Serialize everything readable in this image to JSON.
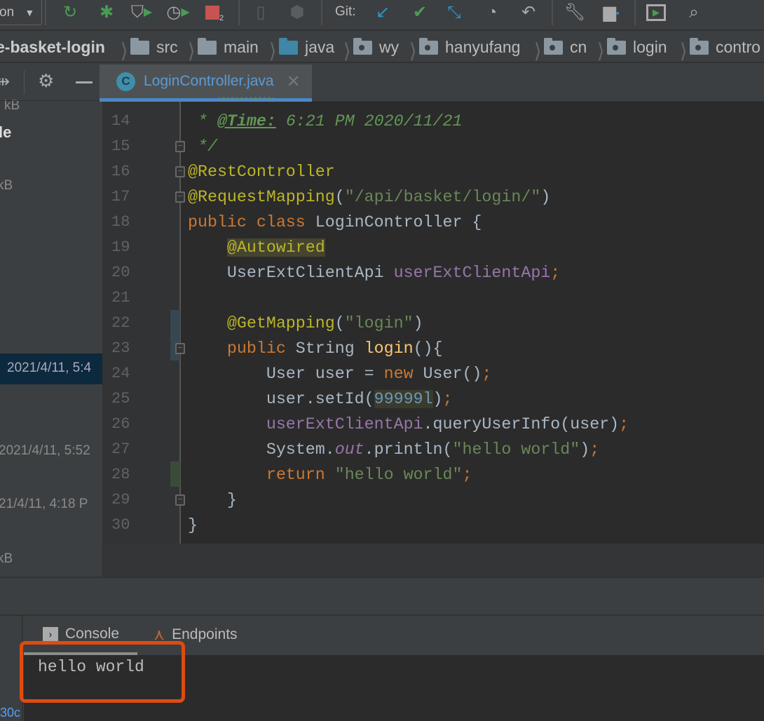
{
  "toolbar": {
    "run_config": "on",
    "stop_badge": "2",
    "git_label": "Git:",
    "icons": [
      "rerun-icon",
      "debug-icon",
      "coverage-icon",
      "profile-icon",
      "stop-icon",
      "device-icon",
      "deploy-icon",
      "git-update-icon",
      "git-commit-icon",
      "git-merge-icon",
      "history-icon",
      "rollback-icon",
      "wrench-icon",
      "project-structure-icon",
      "run-window-icon",
      "search-icon"
    ],
    "colors": {
      "green": "#499c54",
      "red": "#c75450",
      "blue": "#3592c4"
    }
  },
  "breadcrumb": [
    {
      "label": "e-basket-login",
      "icon": "module"
    },
    {
      "label": "src",
      "icon": "folder"
    },
    {
      "label": "main",
      "icon": "folder"
    },
    {
      "label": "java",
      "icon": "source-folder"
    },
    {
      "label": "wy",
      "icon": "package"
    },
    {
      "label": "hanyufang",
      "icon": "package"
    },
    {
      "label": "cn",
      "icon": "package"
    },
    {
      "label": "login",
      "icon": "package"
    },
    {
      "label": "contro",
      "icon": "package"
    }
  ],
  "left_panel": {
    "rows": [
      "kB",
      "le",
      "kB",
      "2021/4/11, 5:4",
      "2021/4/11, 5:52",
      "21/4/11, 4:18 P",
      "kB",
      "30c"
    ]
  },
  "editor": {
    "tab": {
      "name": "LoginController.java",
      "icon": "C"
    },
    "lines": [
      {
        "n": "14",
        "fold": false,
        "tokens": [
          [
            " * ",
            "cmt"
          ],
          [
            "@Time:",
            "tag"
          ],
          [
            " 6:21 PM 2020/11/21",
            "cmt"
          ]
        ]
      },
      {
        "n": "15",
        "fold": true,
        "tokens": [
          [
            " */",
            "cmt"
          ]
        ]
      },
      {
        "n": "16",
        "fold": true,
        "tokens": [
          [
            "@RestController",
            "ann"
          ]
        ]
      },
      {
        "n": "17",
        "fold": true,
        "tokens": [
          [
            "@RequestMapping",
            "ann"
          ],
          [
            "(",
            ""
          ],
          [
            "\"/api/basket/login/\"",
            "str"
          ],
          [
            ")",
            ""
          ]
        ]
      },
      {
        "n": "18",
        "fold": false,
        "tokens": [
          [
            "public class ",
            "kw"
          ],
          [
            "LoginController {",
            ""
          ]
        ]
      },
      {
        "n": "19",
        "fold": false,
        "tokens": [
          [
            "    ",
            ""
          ],
          [
            "@Autowired",
            "ann hl"
          ]
        ]
      },
      {
        "n": "20",
        "fold": false,
        "tokens": [
          [
            "    UserExtClientApi ",
            ""
          ],
          [
            "userExtClientApi",
            "field"
          ],
          [
            ";",
            "kw"
          ]
        ]
      },
      {
        "n": "21",
        "fold": false,
        "tokens": []
      },
      {
        "n": "22",
        "fold": false,
        "tokens": [
          [
            "    ",
            ""
          ],
          [
            "@GetMapping",
            "ann"
          ],
          [
            "(",
            ""
          ],
          [
            "\"login\"",
            "str"
          ],
          [
            ")",
            ""
          ]
        ]
      },
      {
        "n": "23",
        "fold": true,
        "tokens": [
          [
            "    ",
            ""
          ],
          [
            "public ",
            "kw"
          ],
          [
            "String ",
            ""
          ],
          [
            "login",
            "fn"
          ],
          [
            "(){",
            ""
          ]
        ]
      },
      {
        "n": "24",
        "fold": false,
        "tokens": [
          [
            "        User user = ",
            ""
          ],
          [
            "new ",
            "kw"
          ],
          [
            "User()",
            ""
          ],
          [
            ";",
            "kw"
          ]
        ]
      },
      {
        "n": "25",
        "fold": false,
        "tokens": [
          [
            "        user.setId(",
            ""
          ],
          [
            "99999l",
            "num"
          ],
          [
            ")",
            ""
          ],
          [
            ";",
            "kw"
          ]
        ]
      },
      {
        "n": "26",
        "fold": false,
        "tokens": [
          [
            "        ",
            ""
          ],
          [
            "userExtClientApi",
            "field"
          ],
          [
            ".queryUserInfo(user)",
            ""
          ],
          [
            ";",
            "kw"
          ]
        ]
      },
      {
        "n": "27",
        "fold": false,
        "tokens": [
          [
            "        System.",
            ""
          ],
          [
            "out",
            "out"
          ],
          [
            ".println(",
            ""
          ],
          [
            "\"hello world\"",
            "str"
          ],
          [
            ")",
            ""
          ],
          [
            ";",
            "kw"
          ]
        ]
      },
      {
        "n": "28",
        "fold": false,
        "tokens": [
          [
            "        ",
            ""
          ],
          [
            "return ",
            "kw"
          ],
          [
            "\"hello world\"",
            "str"
          ],
          [
            ";",
            "kw"
          ]
        ]
      },
      {
        "n": "29",
        "fold": true,
        "tokens": [
          [
            "    }",
            ""
          ]
        ]
      },
      {
        "n": "30",
        "fold": false,
        "tokens": [
          [
            "}",
            ""
          ]
        ]
      }
    ]
  },
  "tool_window": {
    "tabs": [
      {
        "label": "Console",
        "icon": "console-icon"
      },
      {
        "label": "Endpoints",
        "icon": "endpoints-icon"
      }
    ],
    "console_output": "hello world",
    "highlight_color": "#e04b0e"
  }
}
